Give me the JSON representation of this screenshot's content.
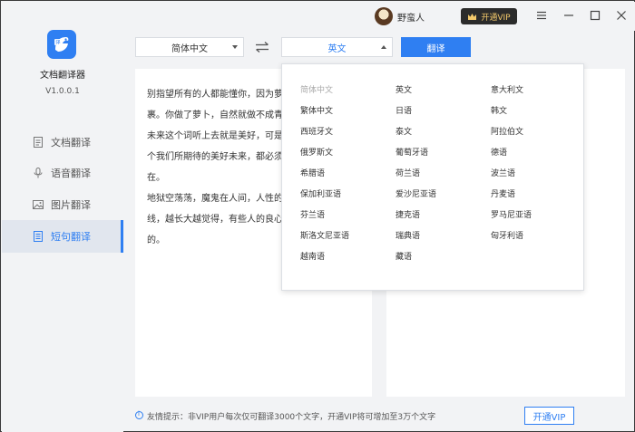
{
  "app": {
    "name": "文档翻译器",
    "version": "V1.0.0.1"
  },
  "user": {
    "name": "野蛮人",
    "vip_label": "开通VIP"
  },
  "sidebar": {
    "items": [
      {
        "label": "文档翻译",
        "icon": "document-icon",
        "active": false
      },
      {
        "label": "语音翻译",
        "icon": "microphone-icon",
        "active": false
      },
      {
        "label": "图片翻译",
        "icon": "image-icon",
        "active": false
      },
      {
        "label": "短句翻译",
        "icon": "sentence-icon",
        "active": true
      }
    ]
  },
  "toolbar": {
    "source_lang": "简体中文",
    "target_lang": "英文",
    "translate_label": "翻译"
  },
  "source": {
    "text": "别指望所有的人都能懂你，因为萝\n裹。你做了萝卜，自然就做不成青\n未来这个词听上去就是美好，可是\n个我们所期待的美好未来，都必须\n在。\n地狱空荡荡，魔鬼在人间，人性的\n线，越长大越觉得，有些人的良心\n的。"
  },
  "languages": {
    "col1": [
      "简体中文",
      "繁体中文",
      "西班牙文",
      "俄罗斯文",
      "希腊语",
      "保加利亚语",
      "芬兰语",
      "斯洛文尼亚语",
      "越南语"
    ],
    "col2": [
      "英文",
      "日语",
      "泰文",
      "葡萄牙语",
      "荷兰语",
      "爱沙尼亚语",
      "捷克语",
      "瑞典语",
      "藏语"
    ],
    "col3": [
      "意大利文",
      "韩文",
      "阿拉伯文",
      "德语",
      "波兰语",
      "丹麦语",
      "罗马尼亚语",
      "匈牙利语"
    ]
  },
  "footer": {
    "tip": "友情提示：非VIP用户每次仅可翻译3000个文字，开通VIP将可增加至3万个文字",
    "vip_label": "开通VIP"
  },
  "colors": {
    "accent": "#2f7ff2",
    "vip_gold": "#f3c96b"
  }
}
